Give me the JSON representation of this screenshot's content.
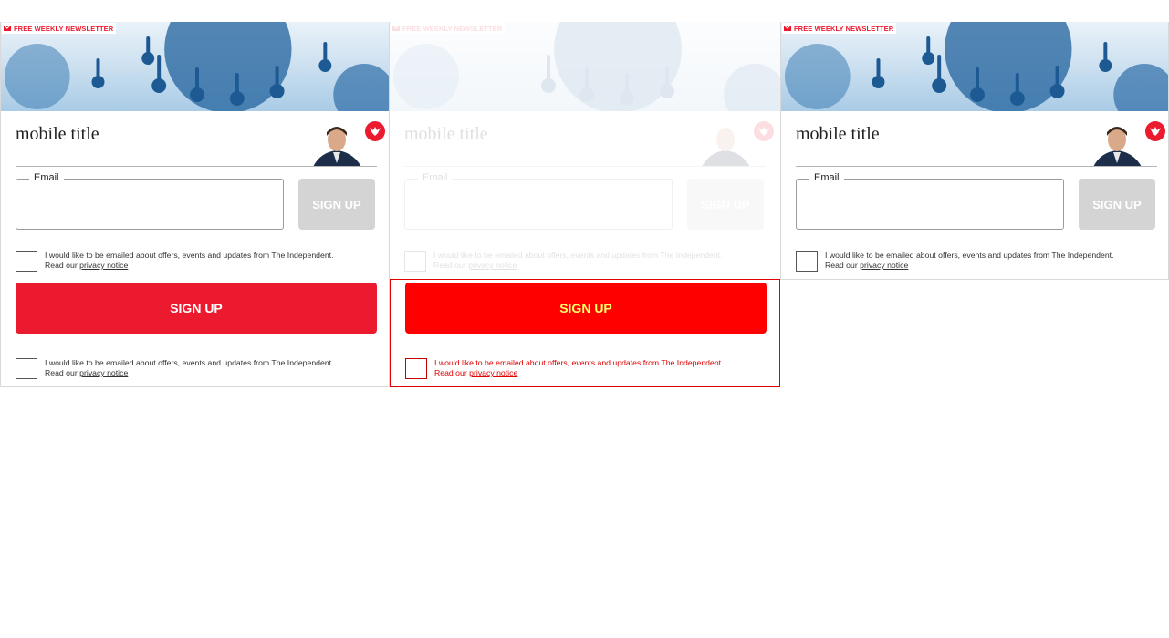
{
  "newsletter_badge": "FREE WEEKLY NEWSLETTER",
  "title": "mobile title",
  "email_label": "Email",
  "signup_small": "SIGN UP",
  "signup_big": "SIGN UP",
  "consent_text": "I would like to be emailed about offers, events and updates from The Independent.",
  "read_our": "Read our",
  "privacy_link": "privacy notice",
  "colors": {
    "brand_red": "#ec1a2e",
    "disabled_button": "#d4d4d4",
    "highlight_red": "#ff0000",
    "highlight_text": "#ffff66"
  },
  "icons": [
    "mail-icon",
    "independent-eagle-logo-icon",
    "author-photo",
    "virus-hero-image"
  ]
}
